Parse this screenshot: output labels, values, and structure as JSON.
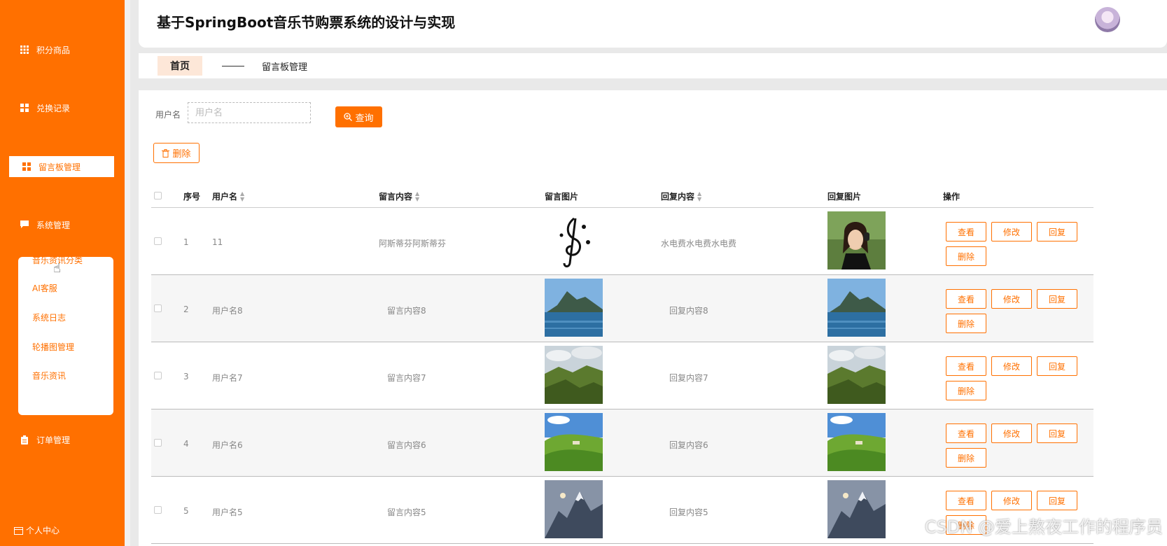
{
  "app": {
    "title": "基于SpringBoot音乐节购票系统的设计与实现"
  },
  "sidebar": {
    "items": [
      {
        "label": "积分商品",
        "icon": "grid-icon"
      },
      {
        "label": "兑换记录",
        "icon": "grid-icon"
      },
      {
        "label": "留言板管理",
        "icon": "grid-icon",
        "active": true
      },
      {
        "label": "系统管理",
        "icon": "chat-icon"
      },
      {
        "label": "订单管理",
        "icon": "clipboard-icon"
      }
    ],
    "submenu": [
      "音乐资讯分类",
      "AI客服",
      "系统日志",
      "轮播图管理",
      "音乐资讯"
    ],
    "footer": {
      "label": "个人中心",
      "icon": "calendar-icon"
    }
  },
  "breadcrumb": {
    "home": "首页",
    "current": "留言板管理"
  },
  "search": {
    "label": "用户名",
    "placeholder": "用户名",
    "button": "查询"
  },
  "toolbar": {
    "delete_label": "删除"
  },
  "table": {
    "columns": [
      "序号",
      "用户名",
      "留言内容",
      "留言图片",
      "回复内容",
      "回复图片",
      "操作"
    ],
    "rows": [
      {
        "index": "1",
        "user": "11",
        "message": "阿斯蒂芬阿斯蒂芬",
        "reply": "水电费水电费水电费",
        "msg_img": "treble-clef",
        "reply_img": "woman-headphones"
      },
      {
        "index": "2",
        "user": "用户名8",
        "message": "留言内容8",
        "reply": "回复内容8",
        "msg_img": "lake-mountain",
        "reply_img": "lake-mountain"
      },
      {
        "index": "3",
        "user": "用户名7",
        "message": "留言内容7",
        "reply": "回复内容7",
        "msg_img": "cliff-valley",
        "reply_img": "cliff-valley"
      },
      {
        "index": "4",
        "user": "用户名6",
        "message": "留言内容6",
        "reply": "回复内容6",
        "msg_img": "green-hills",
        "reply_img": "green-hills"
      },
      {
        "index": "5",
        "user": "用户名5",
        "message": "留言内容5",
        "reply": "回复内容5",
        "msg_img": "snow-mountain",
        "reply_img": "snow-mountain"
      }
    ],
    "actions": {
      "view": "查看",
      "edit": "修改",
      "reply": "回复",
      "delete": "删除"
    }
  },
  "watermark": "CSDN @爱上熬夜工作的程序员",
  "colors": {
    "accent": "#ff7000",
    "sidebar": "#ff7000",
    "breadcrumb_home_bg": "#fde7d8"
  }
}
